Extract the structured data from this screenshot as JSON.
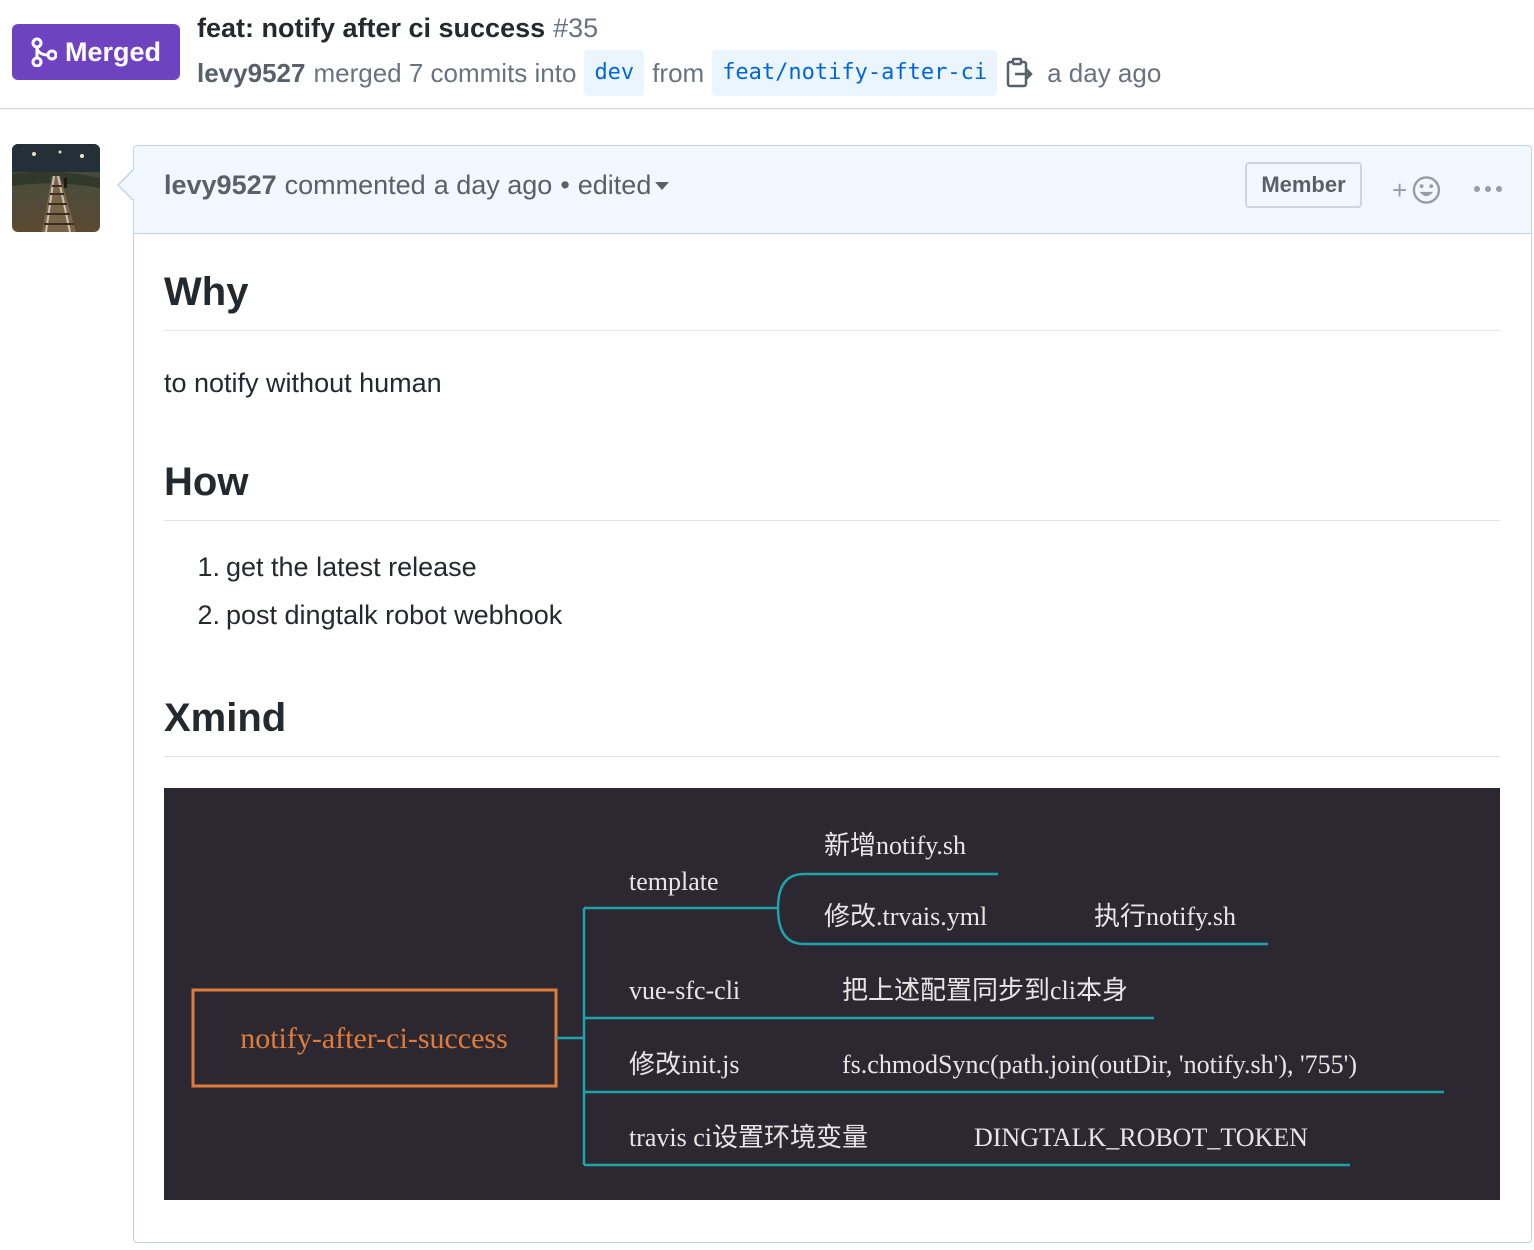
{
  "header": {
    "state_label": "Merged",
    "title": "feat: notify after ci success",
    "number": "#35",
    "author": "levy9527",
    "merged_text": "merged 7 commits into",
    "base_branch": "dev",
    "from_text": "from",
    "head_branch": "feat/notify-after-ci",
    "time": "a day ago"
  },
  "comment": {
    "author": "levy9527",
    "commented": "commented",
    "time": "a day ago",
    "separator": "•",
    "edited": "edited",
    "member_badge": "Member",
    "reaction_plus": "+",
    "body": {
      "h_why": "Why",
      "why_text": "to notify without human",
      "h_how": "How",
      "how_items": [
        {
          "num": "1.",
          "text": "get the latest release"
        },
        {
          "num": "2.",
          "text": "post dingtalk robot webhook"
        }
      ],
      "h_xmind": "Xmind"
    }
  },
  "xmind": {
    "root": "notify-after-ci-success",
    "branches": {
      "template": "template",
      "template_children": [
        "新增notify.sh",
        "修改.trvais.yml"
      ],
      "template_child_detail": "执行notify.sh",
      "vue_sfc_cli": "vue-sfc-cli",
      "vue_sfc_cli_detail": "把上述配置同步到cli本身",
      "init_js": "修改init.js",
      "init_js_detail": "fs.chmodSync(path.join(outDir, 'notify.sh'), '755')",
      "travis": "travis ci设置环境变量",
      "travis_detail": "DINGTALK_ROBOT_TOKEN"
    },
    "colors": {
      "background": "#2c2832",
      "root": "#e07b39",
      "line": "#1fa3a8",
      "text": "#e6e6e6"
    }
  }
}
